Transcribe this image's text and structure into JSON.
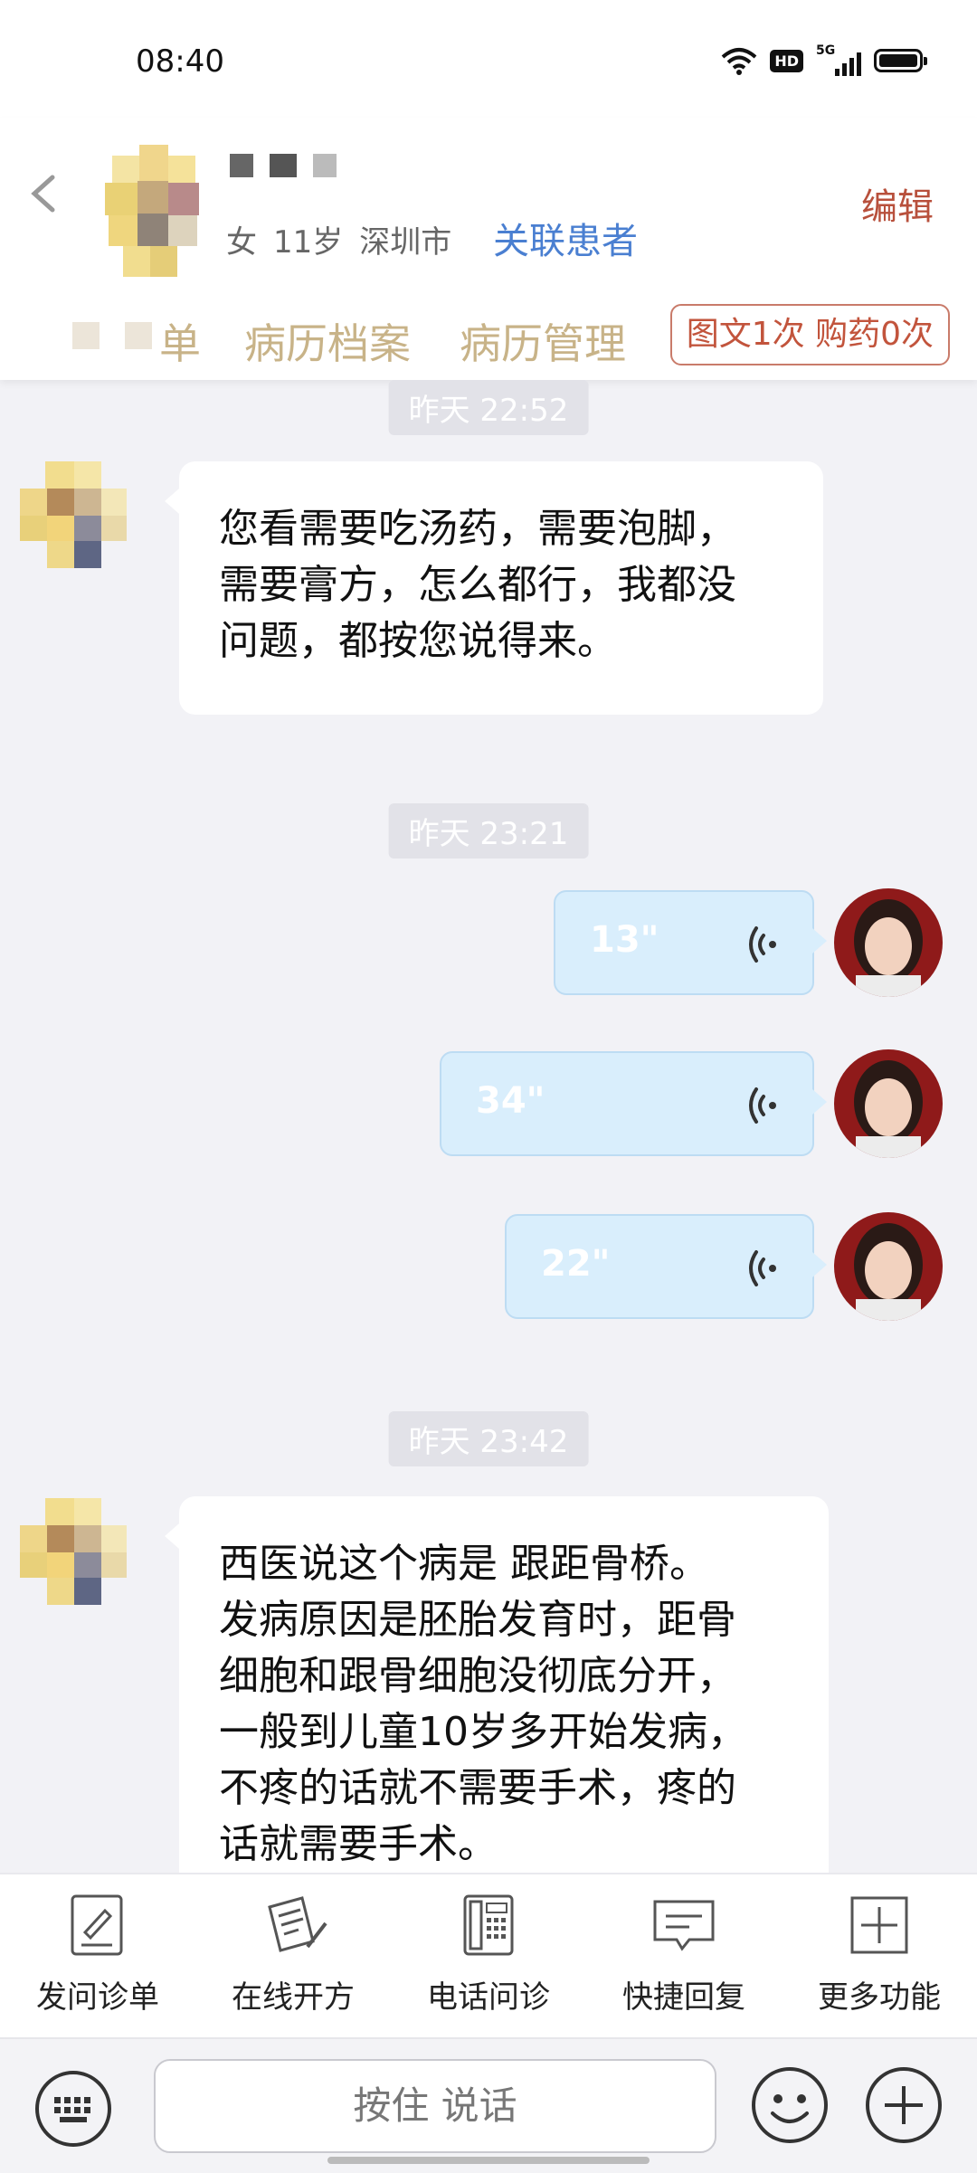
{
  "status_bar": {
    "time": "08:40",
    "hd_label": "HD",
    "network_label": "5G",
    "icons": [
      "wifi-icon",
      "hd-icon",
      "signal-5g-icon",
      "battery-icon"
    ]
  },
  "header": {
    "back_icon": "back-icon",
    "patient": {
      "gender": "女",
      "age": "11岁",
      "city": "深圳市"
    },
    "link_patient_label": "关联患者",
    "edit_label": "编辑",
    "nav": {
      "partial_tab": "单",
      "tabs": [
        "病历档案",
        "病历管理"
      ],
      "count_badge": "图文1次 购药0次"
    }
  },
  "messages": [
    {
      "type": "timestamp",
      "text": "昨天 22:52"
    },
    {
      "type": "text",
      "side": "incoming",
      "lines": [
        "您看需要吃汤药，需要泡脚，",
        "需要膏方，怎么都行，我都没",
        "问题，都按您说得来。"
      ]
    },
    {
      "type": "timestamp",
      "text": "昨天 23:21"
    },
    {
      "type": "voice",
      "side": "outgoing",
      "duration": "13\""
    },
    {
      "type": "voice",
      "side": "outgoing",
      "duration": "34\""
    },
    {
      "type": "voice",
      "side": "outgoing",
      "duration": "22\""
    },
    {
      "type": "timestamp",
      "text": "昨天 23:42"
    },
    {
      "type": "text",
      "side": "incoming",
      "lines": [
        "西医说这个病是  跟距骨桥。",
        "发病原因是胚胎发育时，距骨",
        "细胞和跟骨细胞没彻底分开，",
        "一般到儿童10岁多开始发病，",
        "不疼的话就不需要手术，疼的",
        "话就需要手术。"
      ]
    }
  ],
  "toolbar": {
    "items": [
      {
        "label": "发问诊单",
        "icon": "form-edit-icon"
      },
      {
        "label": "在线开方",
        "icon": "prescription-icon"
      },
      {
        "label": "电话问诊",
        "icon": "phone-icon"
      },
      {
        "label": "快捷回复",
        "icon": "quick-reply-icon"
      },
      {
        "label": "更多功能",
        "icon": "more-plus-icon"
      }
    ]
  },
  "input_bar": {
    "hold_to_talk": "按住 说话",
    "icons": [
      "keyboard-icon",
      "emoji-icon",
      "plus-icon"
    ]
  },
  "colors": {
    "accent_blue": "#4a7fd1",
    "edit_red": "#b8503c",
    "nav_gold": "#c8b388",
    "voice_bubble": "#d9eefc",
    "chat_bg": "#f2f2f6"
  }
}
